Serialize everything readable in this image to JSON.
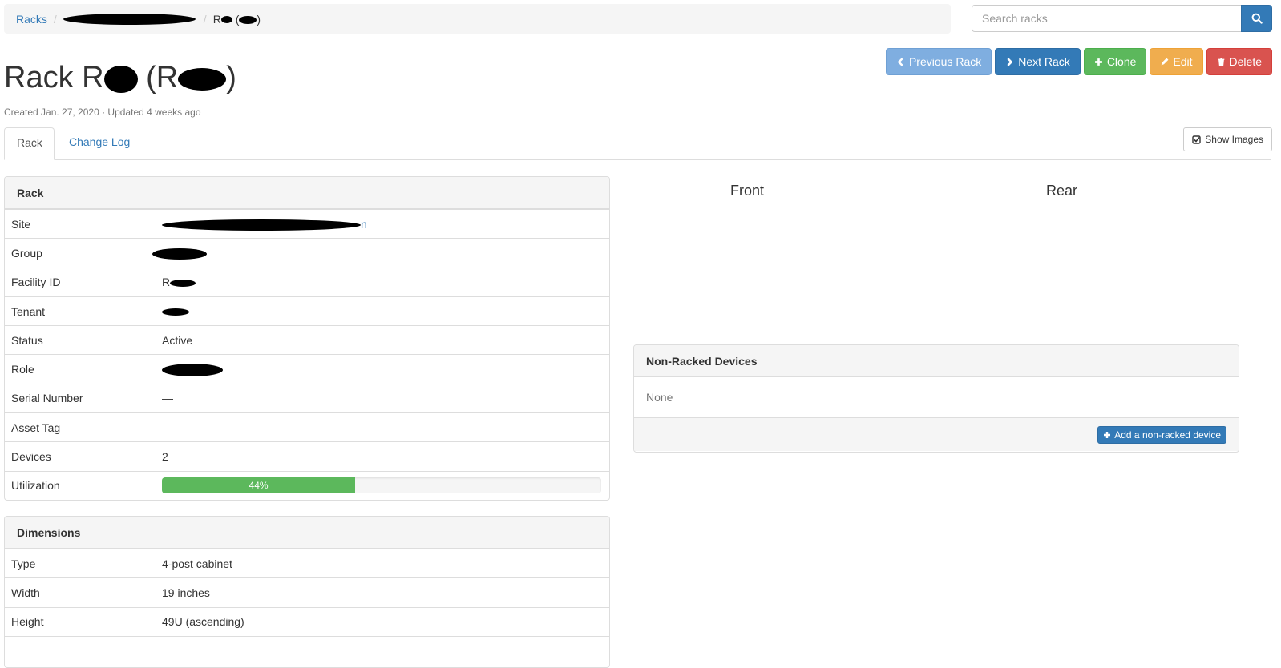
{
  "breadcrumb": {
    "racks": "Racks",
    "sep": "/",
    "current_prefix": "R",
    "current_suffix": ")"
  },
  "search": {
    "placeholder": "Search racks"
  },
  "title": {
    "prefix": "Rack R",
    "mid": " (R",
    "suffix": ")"
  },
  "meta": "Created Jan. 27, 2020 · Updated 4 weeks ago",
  "actions": {
    "previous": "Previous Rack",
    "next": "Next Rack",
    "clone": "Clone",
    "edit": "Edit",
    "delete": "Delete"
  },
  "tabs": {
    "rack": "Rack",
    "changelog": "Change Log"
  },
  "show_images": "Show Images",
  "rack_panel": {
    "heading": "Rack",
    "rows": [
      {
        "key": "Site",
        "value": "n"
      },
      {
        "key": "Group",
        "value": ""
      },
      {
        "key": "Facility ID",
        "value": "R"
      },
      {
        "key": "Tenant",
        "value": ""
      },
      {
        "key": "Status",
        "value": "Active"
      },
      {
        "key": "Role",
        "value": ""
      },
      {
        "key": "Serial Number",
        "value": "—"
      },
      {
        "key": "Asset Tag",
        "value": "—"
      },
      {
        "key": "Devices",
        "value": "2"
      },
      {
        "key": "Utilization",
        "value": "44%"
      }
    ],
    "utilization_fraction": 0.44
  },
  "dimensions_panel": {
    "heading": "Dimensions",
    "rows": [
      {
        "key": "Type",
        "value": "4-post cabinet"
      },
      {
        "key": "Width",
        "value": "19 inches"
      },
      {
        "key": "Height",
        "value": "49U (ascending)"
      }
    ]
  },
  "faces": {
    "front": "Front",
    "rear": "Rear"
  },
  "nonracked": {
    "heading": "Non-Racked Devices",
    "empty": "None",
    "add_button": "Add a non-racked device"
  },
  "colors": {
    "primary": "#337ab7",
    "success": "#5cb85c",
    "warning": "#f0ad4e",
    "danger": "#d9534f",
    "info_light": "#7faee0"
  }
}
